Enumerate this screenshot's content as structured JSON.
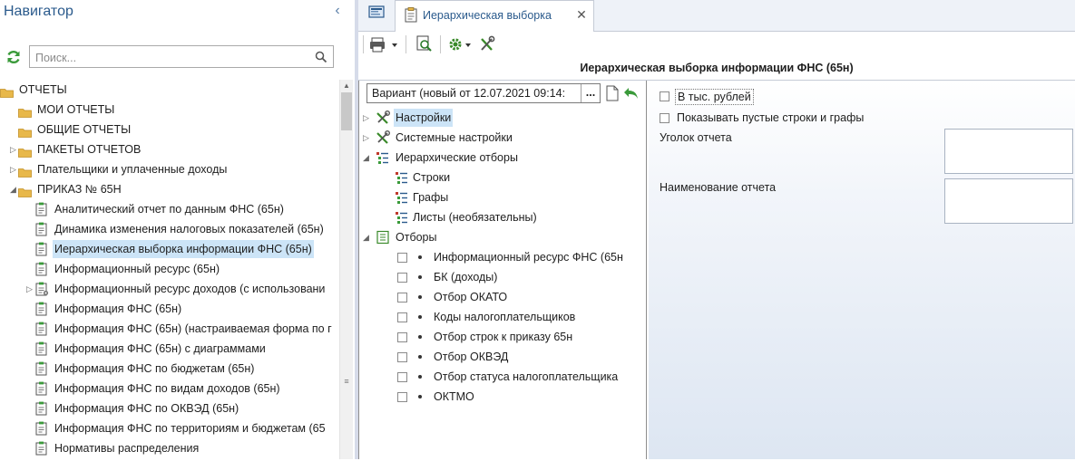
{
  "navigator": {
    "title": "Навигатор",
    "search_placeholder": "Поиск...",
    "tree": [
      {
        "label": "ОТЧЕТЫ",
        "type": "folder",
        "level": 0,
        "expanded": true
      },
      {
        "label": "МОИ ОТЧЕТЫ",
        "type": "folder",
        "level": 1
      },
      {
        "label": "ОБЩИЕ ОТЧЕТЫ",
        "type": "folder",
        "level": 1
      },
      {
        "label": "ПАКЕТЫ ОТЧЕТОВ",
        "type": "folder",
        "level": 1,
        "collapsed": true
      },
      {
        "label": "Плательщики и уплаченные доходы",
        "type": "folder",
        "level": 1,
        "collapsed": true
      },
      {
        "label": "ПРИКАЗ № 65Н",
        "type": "folder",
        "level": 1,
        "expanded": true
      },
      {
        "label": "Аналитический отчет по данным ФНС (65н)",
        "type": "report",
        "level": 2
      },
      {
        "label": "Динамика изменения налоговых показателей (65н)",
        "type": "report",
        "level": 2
      },
      {
        "label": "Иерархическая выборка информации ФНС (65н)",
        "type": "report",
        "level": 2,
        "selected": true
      },
      {
        "label": "Информационный ресурс (65н)",
        "type": "report",
        "level": 2
      },
      {
        "label": "Информационный ресурс доходов (с использовани",
        "type": "report",
        "level": 2,
        "collapsed": true
      },
      {
        "label": "Информация ФНС (65н)",
        "type": "report",
        "level": 2
      },
      {
        "label": "Информация ФНС (65н) (настраиваемая форма по г",
        "type": "report",
        "level": 2
      },
      {
        "label": "Информация ФНС (65н) с диаграммами",
        "type": "report",
        "level": 2
      },
      {
        "label": "Информация ФНС по бюджетам (65н)",
        "type": "report",
        "level": 2
      },
      {
        "label": "Информация ФНС по видам доходов (65н)",
        "type": "report",
        "level": 2
      },
      {
        "label": "Информация ФНС по ОКВЭД (65н)",
        "type": "report",
        "level": 2
      },
      {
        "label": "Информация ФНС по территориям и бюджетам (65",
        "type": "report",
        "level": 2
      },
      {
        "label": "Нормативы распределения",
        "type": "report",
        "level": 2
      }
    ]
  },
  "tabs": [
    {
      "label": "Иерархическая выборка",
      "active": true
    }
  ],
  "report_title": "Иерархическая выборка информации ФНС (65н)",
  "variant_label": "Вариант (новый от 12.07.2021 09:14:",
  "variant_dots": "...",
  "settings_tree": [
    {
      "label": "Настройки",
      "level": 0,
      "selected": true,
      "icon": "tools-icon",
      "collapsed": true
    },
    {
      "label": "Системные настройки",
      "level": 0,
      "icon": "tools-icon",
      "collapsed": true
    },
    {
      "label": "Иерархические отборы",
      "level": 0,
      "icon": "hierarchy-icon",
      "expanded": true
    },
    {
      "label": "Строки",
      "level": 1,
      "icon": "hierarchy-icon"
    },
    {
      "label": "Графы",
      "level": 1,
      "icon": "hierarchy-icon"
    },
    {
      "label": "Листы (необязательны)",
      "level": 1,
      "icon": "hierarchy-icon"
    },
    {
      "label": "Отборы",
      "level": 0,
      "icon": "filter-list-icon",
      "expanded": true
    },
    {
      "label": "Информационный ресурс ФНС (65н",
      "level": 1,
      "checkbox": true,
      "checked": false
    },
    {
      "label": "БК (доходы)",
      "level": 1,
      "checkbox": true,
      "checked": false
    },
    {
      "label": "Отбор ОКАТО",
      "level": 1,
      "checkbox": true,
      "checked": false
    },
    {
      "label": "Коды налогоплательщиков",
      "level": 1,
      "checkbox": true,
      "checked": false
    },
    {
      "label": "Отбор строк к приказу 65н",
      "level": 1,
      "checkbox": true,
      "checked": false
    },
    {
      "label": "Отбор ОКВЭД",
      "level": 1,
      "checkbox": true,
      "checked": false
    },
    {
      "label": "Отбор статуса налогоплательщика",
      "level": 1,
      "checkbox": true,
      "checked": false
    },
    {
      "label": "ОКТМО",
      "level": 1,
      "checkbox": true,
      "checked": false
    }
  ],
  "properties": {
    "thousands_label": "В тыс. рублей",
    "thousands_checked": false,
    "show_empty_label": "Показывать пустые строки и графы",
    "show_empty_checked": false,
    "corner_label": "Уголок отчета",
    "corner_value": "",
    "name_label": "Наименование отчета",
    "name_value": ""
  },
  "colors": {
    "accent": "#2a5a8c",
    "selection": "#cce4f7",
    "folder": "#e8b84a",
    "green": "#3a9a3a"
  }
}
